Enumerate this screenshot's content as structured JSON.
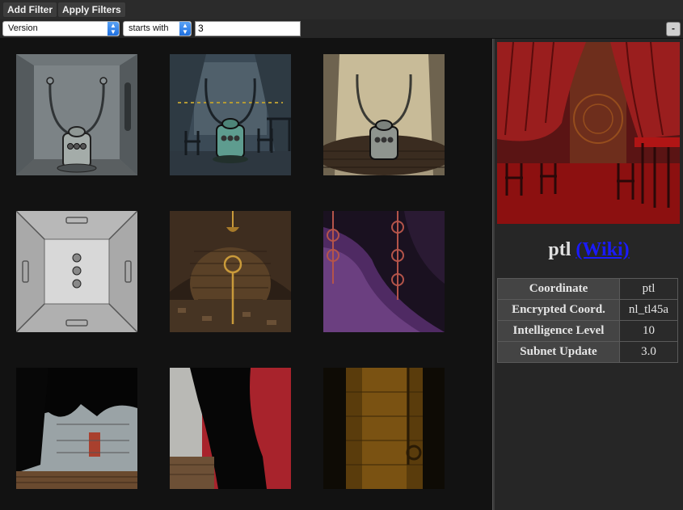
{
  "toolbar": {
    "add_filter_label": "Add Filter",
    "apply_filters_label": "Apply Filters"
  },
  "filter": {
    "field": "Version",
    "operator": "starts with",
    "value": "3",
    "remove_label": "-"
  },
  "gallery": {
    "images": [
      {
        "name": "room-mic-device-grey"
      },
      {
        "name": "room-mic-device-curtains"
      },
      {
        "name": "room-mic-device-stage"
      },
      {
        "name": "room-white-grid-cube"
      },
      {
        "name": "room-brick-ring-tunnel"
      },
      {
        "name": "room-purple-ring-tunnel"
      },
      {
        "name": "room-dark-cave-white"
      },
      {
        "name": "room-dark-cave-red"
      },
      {
        "name": "room-orange-cylinder"
      }
    ]
  },
  "detail": {
    "title": "ptl",
    "wiki_label": "(Wiki)",
    "rows": [
      {
        "key": "Coordinate",
        "value": "ptl"
      },
      {
        "key": "Encrypted Coord.",
        "value": "nl_tl45a"
      },
      {
        "key": "Intelligence Level",
        "value": "10"
      },
      {
        "key": "Subnet Update",
        "value": "3.0"
      }
    ]
  },
  "colors": {
    "background": "#121212",
    "panel": "#262626",
    "link": "#1a1aff",
    "accent_red": "#8b1a1a"
  }
}
